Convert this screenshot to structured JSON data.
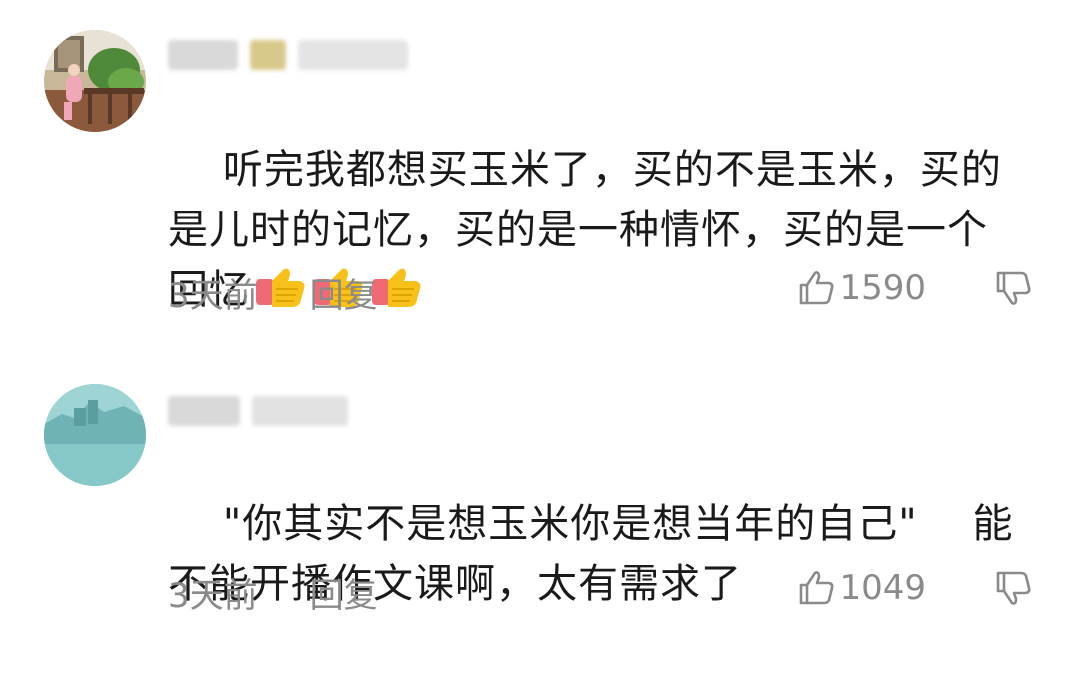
{
  "comments": [
    {
      "text": "听完我都想买玉米了，买的不是玉米，买的是儿时的记忆，买的是一种情怀，买的是一个回忆",
      "emojis": [
        "thumbs-up",
        "thumbs-up",
        "thumbs-up"
      ],
      "time": "3天前",
      "reply_label": "回复",
      "likes": "1590"
    },
    {
      "text": "\"你其实不是想玉米你是想当年的自己\"    能不能开播作文课啊，太有需求了",
      "time": "3天前",
      "reply_label": "回复",
      "likes": "1049"
    }
  ],
  "colors": {
    "text": "#1a1a1a",
    "meta": "#8a8a8a",
    "avatar2": "#7fc2c4"
  }
}
